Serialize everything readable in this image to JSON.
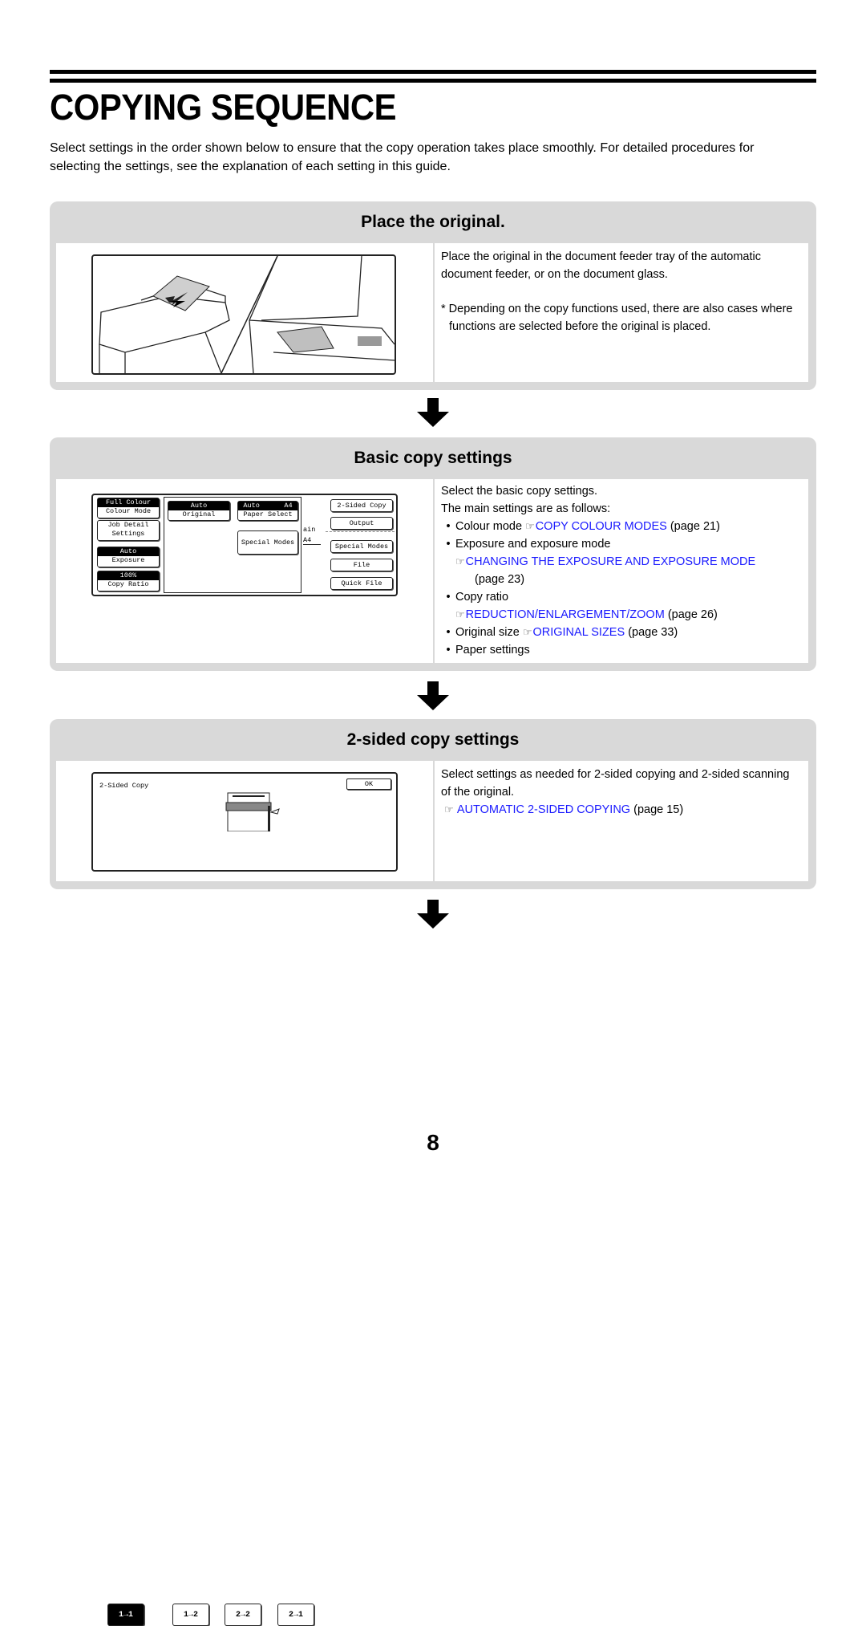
{
  "page": {
    "title": "COPYING SEQUENCE",
    "intro": "Select settings in the order shown below to ensure that the copy operation takes place smoothly. For detailed procedures for selecting the settings, see the explanation of each setting in this guide.",
    "page_number": "8"
  },
  "colors": {
    "link": "#1a1aff",
    "panel_bg": "#d9d9d9"
  },
  "steps": [
    {
      "heading": "Place the original.",
      "text1": "Place the original in the document feeder tray of the automatic document feeder, or on the document glass.",
      "note": "* Depending on the copy functions used, there are also cases where functions are selected before the original is placed."
    },
    {
      "heading": "Basic copy settings",
      "line1": "Select the basic copy settings.",
      "line2": "The main settings are as follows:",
      "items": [
        {
          "label": "Colour mode",
          "link": "COPY COLOUR MODES",
          "page": "(page 21)"
        },
        {
          "label": "Exposure and exposure mode",
          "link": "CHANGING THE EXPOSURE AND EXPOSURE MODE",
          "page": "(page 23)"
        },
        {
          "label": "Copy ratio",
          "link": "REDUCTION/ENLARGEMENT/ZOOM",
          "page": "(page 26)"
        },
        {
          "label": "Original size",
          "link": "ORIGINAL SIZES",
          "page": "(page 33)"
        },
        {
          "label": "Paper settings"
        }
      ],
      "screen": {
        "colour_value": "Full Colour",
        "colour_label": "Colour Mode",
        "job_detail": "Job Detail",
        "job_settings": "Settings",
        "exposure_value": "Auto",
        "exposure_label": "Exposure",
        "ratio_value": "100%",
        "ratio_label": "Copy Ratio",
        "original_value": "Auto",
        "original_label": "Original",
        "paper_value": "Auto      A4",
        "paper_label": "Paper Select",
        "special_modes": "Special Modes",
        "bg_text1": "ain",
        "bg_text2": "A4",
        "right_buttons": [
          "2-Sided Copy",
          "Output",
          "Special Modes",
          "File",
          "Quick File"
        ]
      }
    },
    {
      "heading": "2-sided copy settings",
      "text1": "Select settings as needed for 2-sided copying and 2-sided scanning of the original.",
      "link": "AUTOMATIC 2-SIDED COPYING",
      "page": "(page 15)",
      "screen": {
        "title": "2-Sided Copy",
        "ok": "OK",
        "modes": [
          "1→1",
          "1→2",
          "2→2",
          "2→1"
        ]
      }
    }
  ],
  "icons": {
    "reference": "pointing-hand",
    "flow": "down-arrow"
  }
}
